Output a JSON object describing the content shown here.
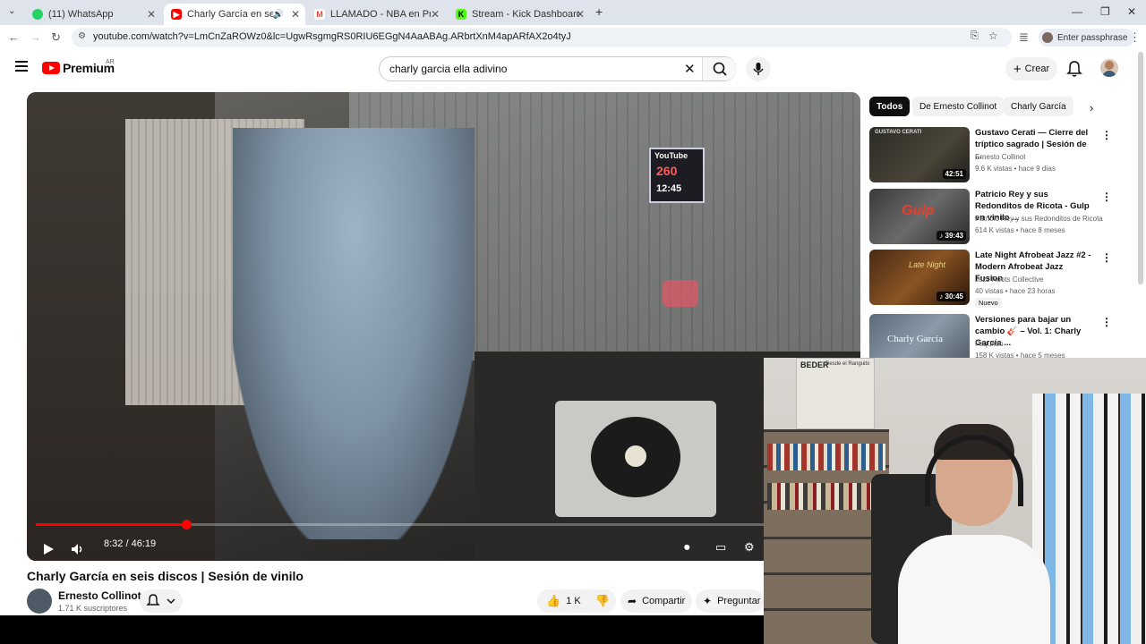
{
  "browser": {
    "tabs": [
      {
        "title": "(11) WhatsApp",
        "favicon": "whatsapp-icon",
        "color": "#25d366"
      },
      {
        "title": "Charly García en seis discos",
        "favicon": "youtube-icon",
        "color": "#ff0000"
      },
      {
        "title": "LLAMADO - NBA en Prime, JAN",
        "favicon": "gmail-icon",
        "color": "#ea4335"
      },
      {
        "title": "Stream - Kick Dashboard",
        "favicon": "kick-icon",
        "color": "#53fc18"
      }
    ],
    "url": "youtube.com/watch?v=LmCnZaROWz0&lc=UgwRsgmgRS0RIU6EGgN4AaABAg.ARbrtXnM4apARfAX2o4tyJ",
    "passphrase_label": "Enter passphrase"
  },
  "youtube": {
    "logo_text": "Premium",
    "country_code": "AR",
    "search_query": "charly garcia ella adivino",
    "create_label": "Crear"
  },
  "video": {
    "title": "Charly García en seis discos | Sesión de vinilo",
    "time": "8:32 / 46:19",
    "progress": 0.184,
    "sign_line1": "YouTube",
    "sign_line2": "260",
    "sign_line3": "12:45",
    "channel": "Ernesto Collinot",
    "subscribers": "1.71 K suscriptores",
    "likes": "1 K",
    "share_label": "Compartir",
    "ask_label": "Preguntar"
  },
  "chips": [
    "Todos",
    "De Ernesto Collinot",
    "Charly García"
  ],
  "recommendations": [
    {
      "title": "Gustavo Cerati — Cierre del tríptico sagrado | Sesión de ...",
      "channel": "Ernesto Collinot",
      "meta": "9.6 K vistas • hace 9 días",
      "duration": "42:51",
      "badge": ""
    },
    {
      "title": "Patricio Rey y sus Redonditos de Ricota - Gulp en vinilo ...",
      "channel": "Patricio Rey y sus Redonditos de Ricota",
      "meta": "614 K vistas • hace 8 meses",
      "duration": "39:43",
      "badge": ""
    },
    {
      "title": "Late Night Afrobeat Jazz #2 - Modern Afrobeat Jazz Fusion",
      "channel": "Jazz Roots Collective",
      "meta": "40 vistas • hace 23 horas",
      "duration": "30:45",
      "badge": "Nuevo"
    },
    {
      "title": "Versiones para bajar un cambio 🎸 – Vol. 1: Charly García ...",
      "channel": "Faqundo",
      "meta": "158 K vistas • hace 5 meses",
      "duration": "",
      "badge": ""
    }
  ],
  "webcam": {
    "poster_title": "BEDER",
    "poster_sub": "Desde el Ranguito"
  }
}
